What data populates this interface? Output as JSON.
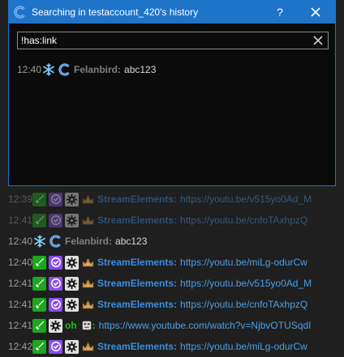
{
  "dialog": {
    "title": "Searching in testaccount_420's history",
    "help_label": "?",
    "search_value": "!has:link",
    "result": {
      "time": "12:40",
      "user": "Felanbird:",
      "message": "abc123"
    }
  },
  "chat": {
    "lines": [
      {
        "time": "12:39",
        "user": "StreamElements:",
        "link": "https://youtu.be/v515yo0Ad_M"
      },
      {
        "time": "12:41",
        "user": "StreamElements:",
        "link": "https://youtu.be/cnfoTAxhpzQ"
      },
      {
        "time": "12:40",
        "user": "Felanbird:",
        "message": "abc123"
      },
      {
        "time": "12:40",
        "user": "StreamElements:",
        "link": "https://youtu.be/miLg-odurCw"
      },
      {
        "time": "12:41",
        "user": "StreamElements:",
        "link": "https://youtu.be/v515yo0Ad_M"
      },
      {
        "time": "12:41",
        "user": "StreamElements:",
        "link": "https://youtu.be/cnfoTAxhpzQ"
      },
      {
        "time": "12:41",
        "user": "oh",
        "link": "https://www.youtube.com/watch?v=NjbvOTUSqdI"
      },
      {
        "time": "12:42",
        "user": "StreamElements:",
        "link": "https://youtu.be/miLg-odurCw"
      }
    ]
  },
  "colors": {
    "accent": "#1e74c9",
    "link": "#4d9fe6",
    "streamelements": "#3c8de0",
    "mod_badge": "#1fa51f",
    "sub_badge": "#8a4fe6"
  },
  "icons": [
    "chatterino-logo-icon",
    "snowflake-icon",
    "moderator-sword-icon",
    "verified-check-icon",
    "gear-icon",
    "crown-icon",
    "close-icon"
  ]
}
